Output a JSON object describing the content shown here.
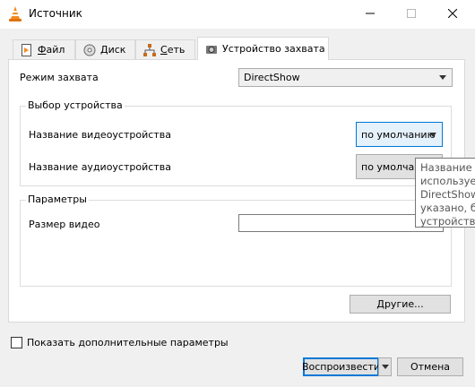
{
  "window": {
    "title": "Источник",
    "controls": [
      "minimize",
      "maximize",
      "close"
    ]
  },
  "tabs": [
    {
      "label": "Файл",
      "mnemonic": "Ф",
      "rest": "айл",
      "icon": "file-icon"
    },
    {
      "label": "Диск",
      "mnemonic": "Д",
      "rest": "иск",
      "icon": "disc-icon"
    },
    {
      "label": "Сеть",
      "mnemonic": "С",
      "rest": "еть",
      "icon": "network-icon"
    },
    {
      "label": "Устройство захвата",
      "mnemonic": "",
      "rest": "Устройство захвата",
      "icon": "capture-device-icon",
      "active": true
    }
  ],
  "capture": {
    "mode_label": "Режим захвата",
    "mode_value": "DirectShow"
  },
  "device_group": {
    "title": "Выбор устройства",
    "video_label": "Название видеоустройства",
    "video_value": "по умолчанию",
    "audio_label": "Название аудиоустройства",
    "audio_value": "по умолчанию"
  },
  "params_group": {
    "title": "Параметры",
    "video_size_label": "Размер видео",
    "video_size_value": ""
  },
  "other_button": "Другие...",
  "tooltip_lines": [
    "Название в",
    "используем",
    "DirectShow.",
    "указано, бу",
    "устройство"
  ],
  "show_more": {
    "label": "Показать дополнительные параметры",
    "checked": false
  },
  "footer": {
    "play_label": "Воспроизвести",
    "cancel_label": "Отмена"
  }
}
